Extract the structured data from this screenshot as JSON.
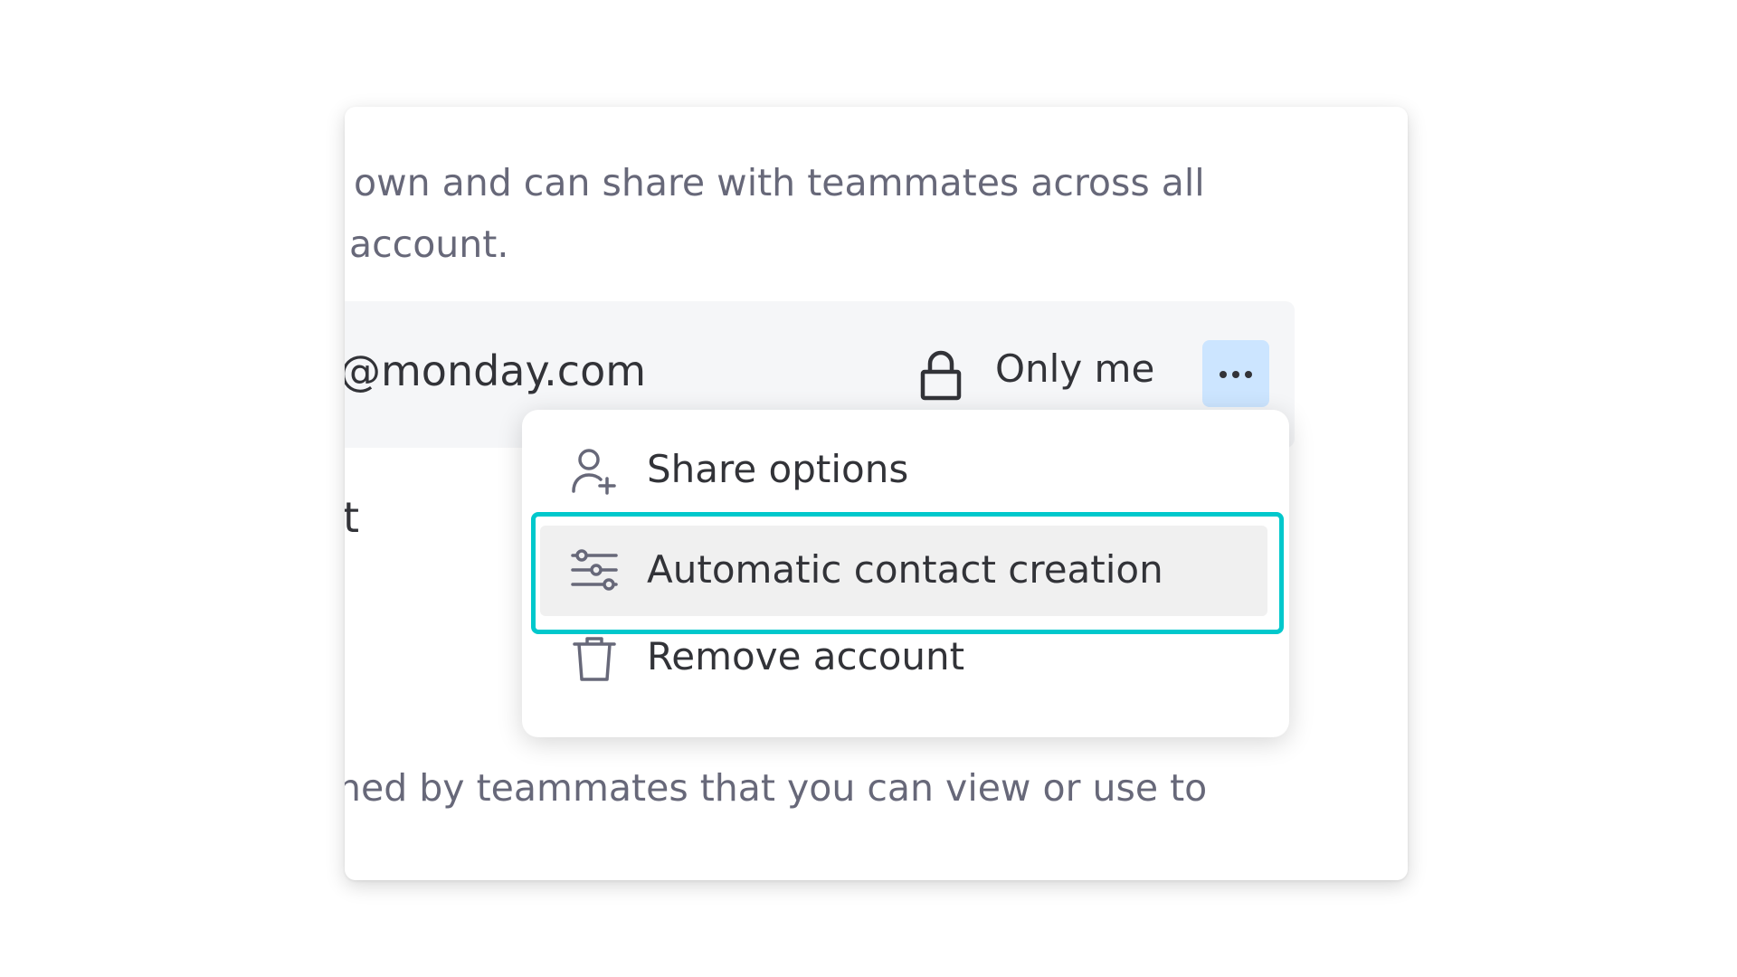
{
  "description_top": {
    "line1": "own and can share with teammates across all",
    "line2": "account."
  },
  "account_row": {
    "email": "@monday.com",
    "visibility_icon": "lock-icon",
    "visibility": "Only me",
    "more_icon": "more-horizontal-icon"
  },
  "left_fragment": "t",
  "description_bottom": "ned by teammates that you can view or use to",
  "menu": {
    "items": [
      {
        "label": "Share options",
        "icon": "person-add-icon"
      },
      {
        "label": "Automatic contact creation",
        "icon": "filter-sliders-icon"
      },
      {
        "label": "Remove account",
        "icon": "trash-icon"
      }
    ]
  },
  "colors": {
    "highlight": "#00c8cc",
    "more_button_bg": "#cce5ff",
    "row_bg": "#f5f6f8",
    "hovered_item_bg": "#f0f0f0"
  }
}
